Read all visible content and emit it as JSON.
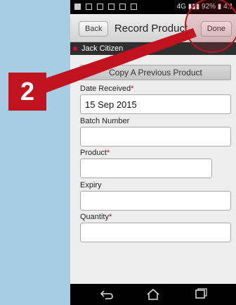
{
  "status_bar": {
    "right_text": "4G ▮▮▮ 92% ▮ 4:1"
  },
  "app_bar": {
    "back_label": "Back",
    "title": "Record Product",
    "done_label": "Done"
  },
  "user_bar": {
    "name": "Jack Citizen"
  },
  "form": {
    "copy_label": "Copy A Previous Product",
    "date_received": {
      "label": "Date Received",
      "value": "15 Sep 2015"
    },
    "batch_number": {
      "label": "Batch Number",
      "value": ""
    },
    "product": {
      "label": "Product",
      "value": ""
    },
    "expiry": {
      "label": "Expiry",
      "value": ""
    },
    "quantity": {
      "label": "Quantity",
      "value": ""
    },
    "required_marker": "*"
  },
  "callout": {
    "number": "2",
    "color": "#c1121f"
  },
  "nav_icons": [
    "back-icon",
    "home-icon",
    "recent-apps-icon"
  ]
}
